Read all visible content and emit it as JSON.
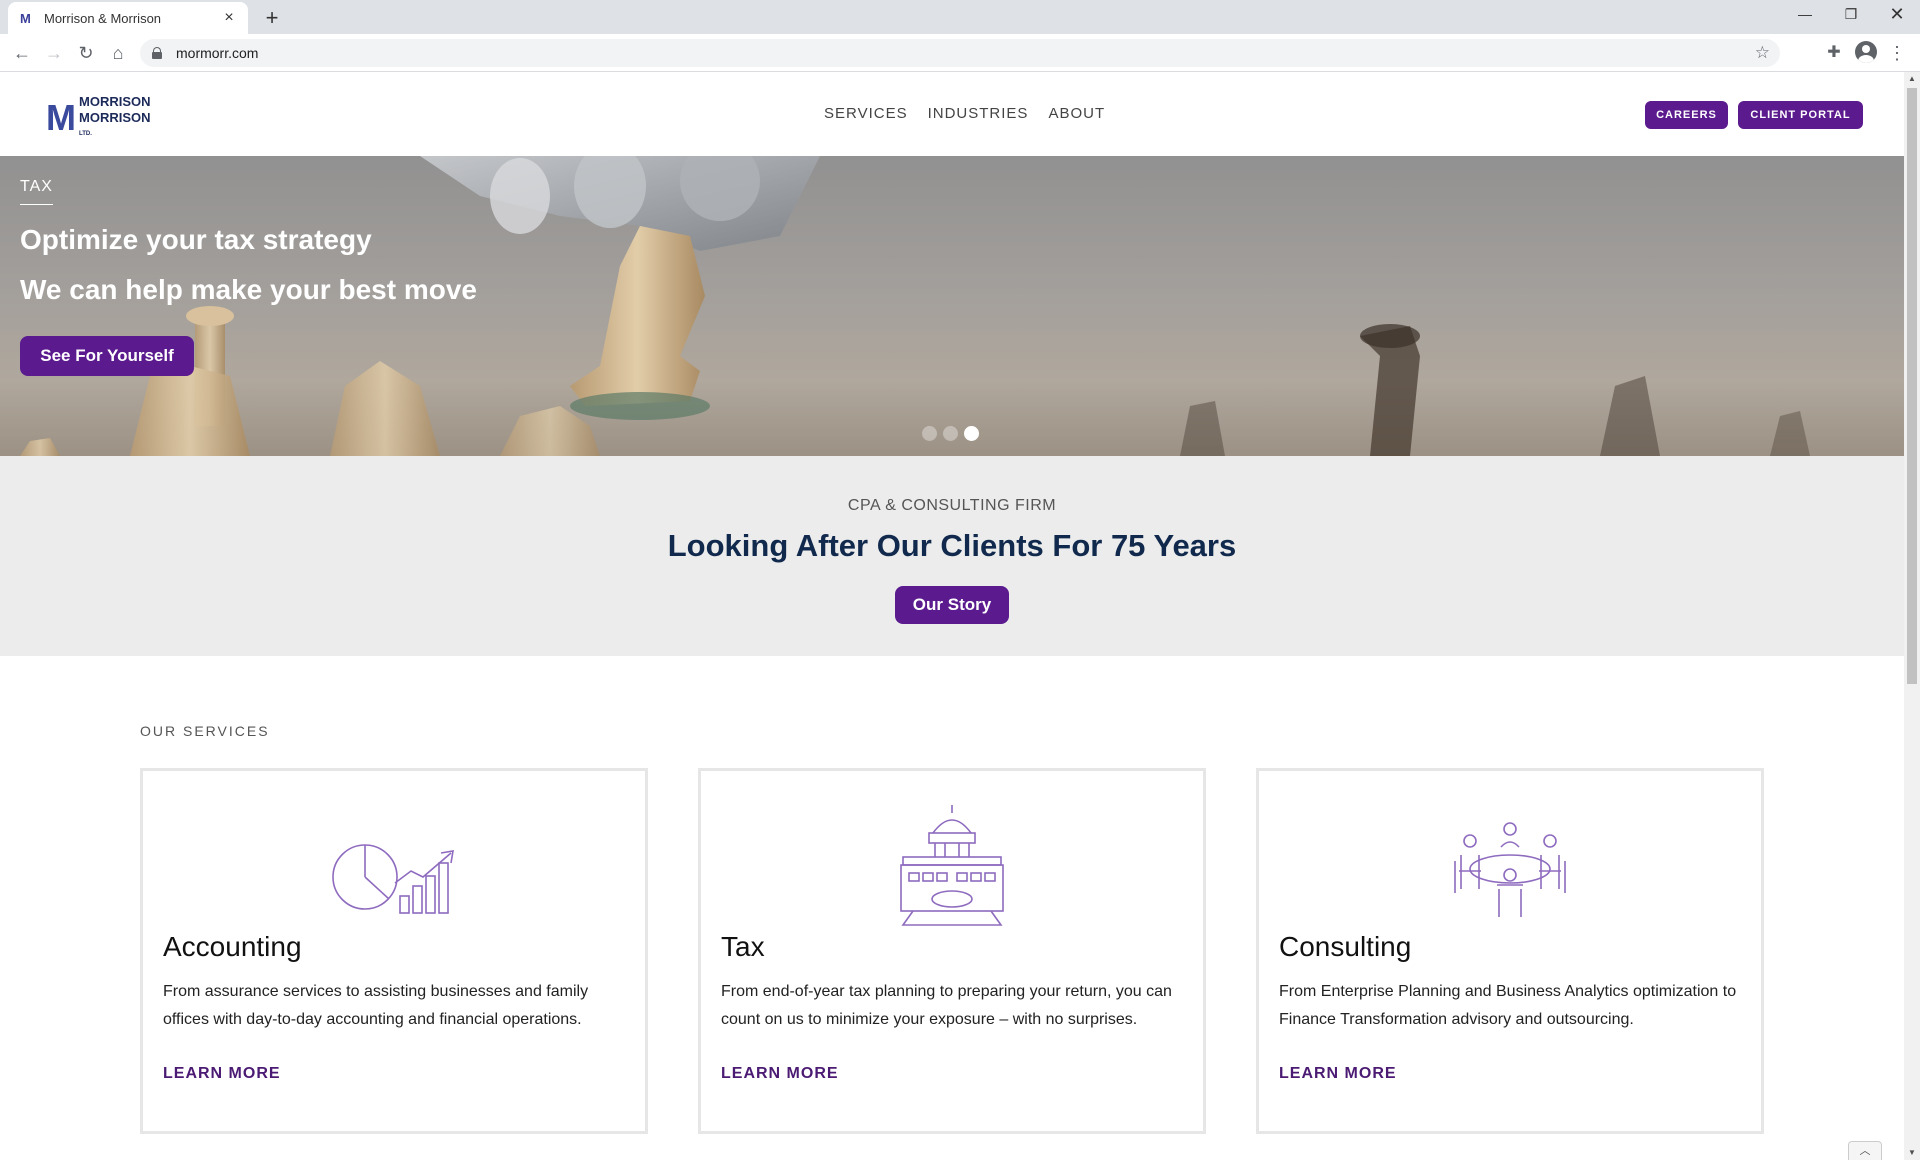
{
  "browser": {
    "tab_title": "Morrison & Morrison",
    "favicon_text": "M",
    "url": "mormorr.com",
    "new_tab_glyph": "+",
    "tab_close_glyph": "×"
  },
  "header": {
    "logo_mark": "M",
    "logo_line1": "MORRISON",
    "logo_line2": "MORRISON",
    "logo_suffix": "LTD.",
    "nav": [
      {
        "label": "SERVICES"
      },
      {
        "label": "INDUSTRIES"
      },
      {
        "label": "ABOUT"
      }
    ],
    "careers_label": "CAREERS",
    "portal_label": "CLIENT PORTAL"
  },
  "hero": {
    "eyebrow": "TAX",
    "headline": "Optimize your tax strategy",
    "subheadline": "We can help make your best move",
    "cta_label": "See For Yourself",
    "slides_total": 3,
    "active_slide": 3
  },
  "intro": {
    "eyebrow": "CPA & CONSULTING FIRM",
    "title": "Looking After Our Clients For 75 Years",
    "cta_label": "Our Story"
  },
  "services": {
    "label": "OUR SERVICES",
    "cards": [
      {
        "icon": "chart-growth-icon",
        "title": "Accounting",
        "description": "From assurance services to assisting businesses and family offices with day-to-day accounting and financial operations.",
        "link_label": "LEARN MORE"
      },
      {
        "icon": "capitol-building-icon",
        "title": "Tax",
        "description": "From end-of-year tax planning to preparing your return, you can count on us to minimize your exposure – with no surprises.",
        "link_label": "LEARN MORE"
      },
      {
        "icon": "meeting-table-icon",
        "title": "Consulting",
        "description": "From Enterprise Planning and Business Analytics optimization to Finance Transformation advisory and outsourcing.",
        "link_label": "LEARN MORE"
      }
    ]
  },
  "colors": {
    "brand_purple": "#5b1a8e",
    "link_purple": "#4b1a73",
    "navy": "#10294d",
    "icon_purple": "#8e6bbf"
  }
}
